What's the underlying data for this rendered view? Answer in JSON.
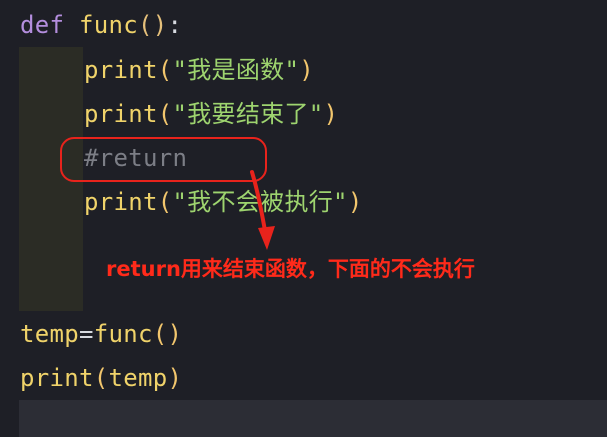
{
  "code": {
    "line1": {
      "kw": "def",
      "fn": "func",
      "paren": "()",
      "colon": ":"
    },
    "line2": {
      "fn": "print",
      "open": "(",
      "str": "\"我是函数\"",
      "close": ")"
    },
    "line3": {
      "fn": "print",
      "open": "(",
      "str": "\"我要结束了\"",
      "close": ")"
    },
    "line4": {
      "comment": "#return"
    },
    "line5": {
      "fn": "print",
      "open": "(",
      "str": "\"我不会被执行\"",
      "close": ")"
    },
    "line6": {
      "var": "temp",
      "op": "=",
      "fn": "func",
      "paren": "()"
    },
    "line7": {
      "fn": "print",
      "open": "(",
      "arg": "temp",
      "close": ")"
    }
  },
  "annotation": {
    "text": "return用来结束函数，下面的不会执行",
    "color": "#ff2a1a"
  },
  "colors": {
    "background": "#1e1f26",
    "keyword": "#b48ede",
    "function": "#f0d36a",
    "string": "#9ed46f",
    "comment": "#7c7e86"
  }
}
